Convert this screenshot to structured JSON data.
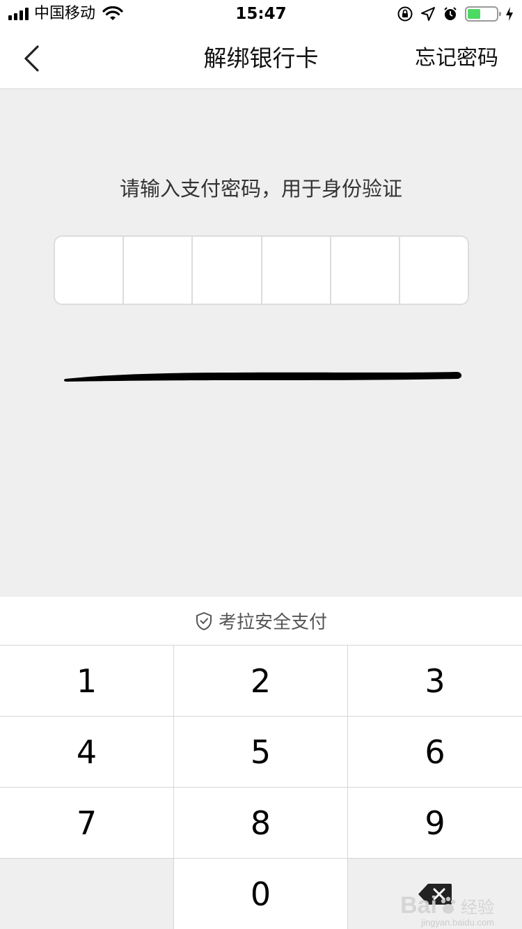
{
  "status_bar": {
    "carrier": "中国移动",
    "time": "15:47"
  },
  "nav": {
    "title": "解绑银行卡",
    "forgot_label": "忘记密码"
  },
  "main": {
    "prompt": "请输入支付密码，用于身份验证",
    "pin_length": 6
  },
  "keyboard": {
    "secure_label": "考拉安全支付",
    "keys": [
      "1",
      "2",
      "3",
      "4",
      "5",
      "6",
      "7",
      "8",
      "9",
      "",
      "0",
      ""
    ]
  },
  "watermark": {
    "logo": "Bai",
    "text": "经验",
    "url": "jingyan.baidu.com"
  },
  "colors": {
    "battery_fill": "#4cd964",
    "page_bg": "#efefef"
  }
}
